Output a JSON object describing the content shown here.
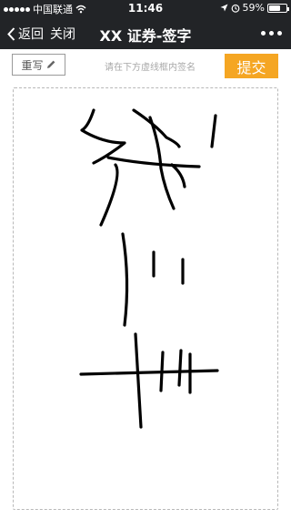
{
  "status_bar": {
    "carrier": "中国联通",
    "time": "11:46",
    "battery_percent": "59%",
    "battery_level": 0.59,
    "icons": [
      "signal-dots-icon",
      "wifi-icon",
      "location-arrow-icon",
      "alarm-icon",
      "battery-icon"
    ]
  },
  "nav": {
    "back_label": "返回",
    "close_label": "关闭",
    "title": "XX 证券-签字",
    "more_icon": "more-dots-icon"
  },
  "toolbar": {
    "rewrite_label": "重写",
    "rewrite_icon": "pencil-icon",
    "hint": "请在下方虚线框内签名",
    "submit_label": "提交"
  },
  "colors": {
    "bar_background": "#222427",
    "submit_background": "#f5a623",
    "ink": "#000000"
  }
}
